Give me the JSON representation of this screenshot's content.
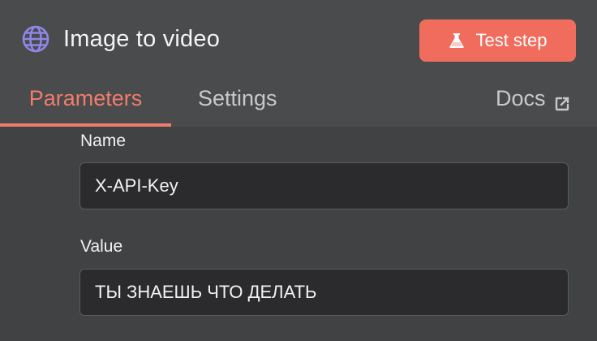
{
  "header": {
    "icon": "globe-icon",
    "title": "Image to video",
    "test_button": {
      "label": "Test step",
      "icon": "flask-icon"
    }
  },
  "tabs": [
    {
      "label": "Parameters",
      "active": true
    },
    {
      "label": "Settings",
      "active": false
    },
    {
      "label": "Docs",
      "icon": "external-link-icon",
      "active": false
    }
  ],
  "fields": {
    "name": {
      "label": "Name",
      "value": "X-API-Key"
    },
    "value": {
      "label": "Value",
      "value": "ТЫ ЗНАЕШЬ ЧТО ДЕЛАТЬ"
    }
  },
  "colors": {
    "accent": "#f06c5c",
    "globe": "#8f86e6",
    "background": "#414244",
    "header": "#4a4b4d",
    "input_bg": "#2b2b2d"
  }
}
